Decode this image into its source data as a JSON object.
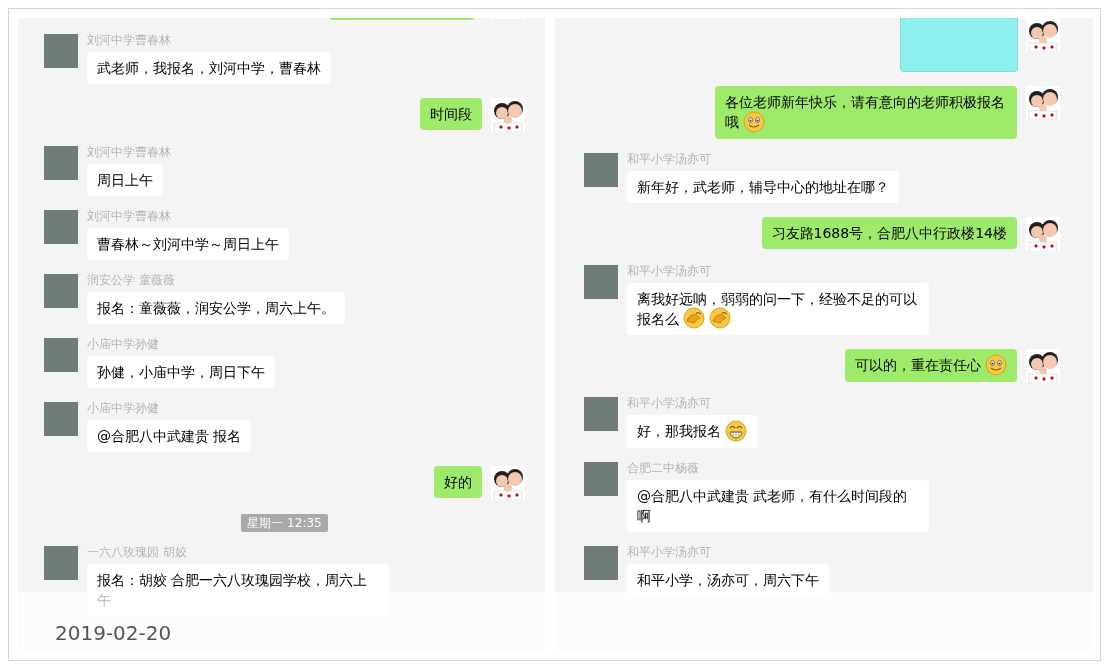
{
  "left_panel": {
    "messages": [
      {
        "kind": "out_cut"
      },
      {
        "kind": "in",
        "sender": "刘河中学曹春林",
        "text": "武老师，我报名，刘河中学，曹春林"
      },
      {
        "kind": "out",
        "text": "时间段"
      },
      {
        "kind": "in",
        "sender": "刘河中学曹春林",
        "text": "周日上午"
      },
      {
        "kind": "in",
        "sender": "刘河中学曹春林",
        "text": "曹春林～刘河中学～周日上午"
      },
      {
        "kind": "in",
        "sender": "润安公学 童薇薇",
        "text": "报名：童薇薇，润安公学，周六上午。"
      },
      {
        "kind": "in",
        "sender": "小庙中学孙健",
        "text": "孙健，小庙中学，周日下午"
      },
      {
        "kind": "in",
        "sender": "小庙中学孙健",
        "text": "@合肥八中武建贵 报名"
      },
      {
        "kind": "out",
        "text": "好的"
      },
      {
        "kind": "time",
        "text": "星期一 12:35"
      },
      {
        "kind": "in",
        "sender": "一六八玫瑰园 胡姣",
        "text": "报名：胡姣 合肥一六八玫瑰园学校，周六上午"
      }
    ]
  },
  "right_panel": {
    "messages": [
      {
        "kind": "image"
      },
      {
        "kind": "out",
        "text": "各位老师新年快乐，请有意向的老师积极报名哦",
        "emojis": [
          {
            "kind": "smile"
          }
        ]
      },
      {
        "kind": "in",
        "sender": "和平小学汤亦可",
        "text": "新年好，武老师，辅导中心的地址在哪？"
      },
      {
        "kind": "out",
        "text": "习友路1688号，合肥八中行政楼14楼"
      },
      {
        "kind": "in",
        "sender": "和平小学汤亦可",
        "text": "离我好远呐，弱弱的问一下，经验不足的可以报名么",
        "emojis": [
          {
            "kind": "cover"
          },
          {
            "kind": "cover"
          }
        ]
      },
      {
        "kind": "out",
        "text": "可以的，重在责任心",
        "emojis": [
          {
            "kind": "smile"
          }
        ]
      },
      {
        "kind": "in",
        "sender": "和平小学汤亦可",
        "text": "好，那我报名",
        "emojis": [
          {
            "kind": "grin"
          }
        ]
      },
      {
        "kind": "in",
        "sender": "合肥二中杨薇",
        "text": "@合肥八中武建贵 武老师，有什么时间段的啊"
      },
      {
        "kind": "in",
        "sender": "和平小学汤亦可",
        "text": "和平小学，汤亦可，周六下午"
      }
    ]
  },
  "overlay": {
    "date": "2019-02-20"
  }
}
